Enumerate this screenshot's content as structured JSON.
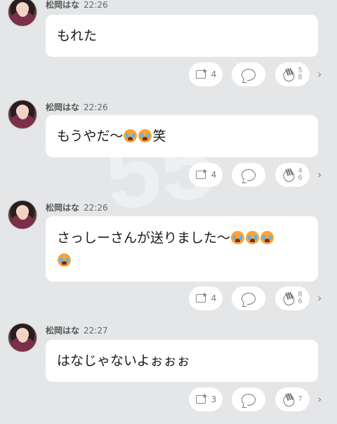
{
  "posts": [
    {
      "name": "松岡はな",
      "time": "22:26",
      "text": "もれた",
      "emoji_count": 0,
      "suffix": "",
      "retweets": "4",
      "claps_top": "5",
      "claps_bottom": "8"
    },
    {
      "name": "松岡はな",
      "time": "22:26",
      "text": "もうやだ〜",
      "emoji_count": 2,
      "suffix": "笑",
      "retweets": "4",
      "claps_top": "4",
      "claps_bottom": "6"
    },
    {
      "name": "松岡はな",
      "time": "22:26",
      "text": "さっしーさんが送りました〜",
      "emoji_count": 4,
      "suffix": "",
      "retweets": "4",
      "claps_top": "8",
      "claps_bottom": "6"
    },
    {
      "name": "松岡はな",
      "time": "22:27",
      "text": "はなじゃないよぉぉぉ",
      "emoji_count": 0,
      "suffix": "",
      "retweets": "3",
      "claps_top": "",
      "claps_bottom": "7"
    }
  ],
  "icons": {
    "retweet": "retweet-icon",
    "comment": "comment-icon",
    "clap": "clap-icon",
    "more": "chevron-right-icon",
    "emoji": "crying-face-emoji"
  },
  "colors": {
    "background": "#e4e6e8",
    "bubble": "#ffffff",
    "icon": "#777777"
  }
}
